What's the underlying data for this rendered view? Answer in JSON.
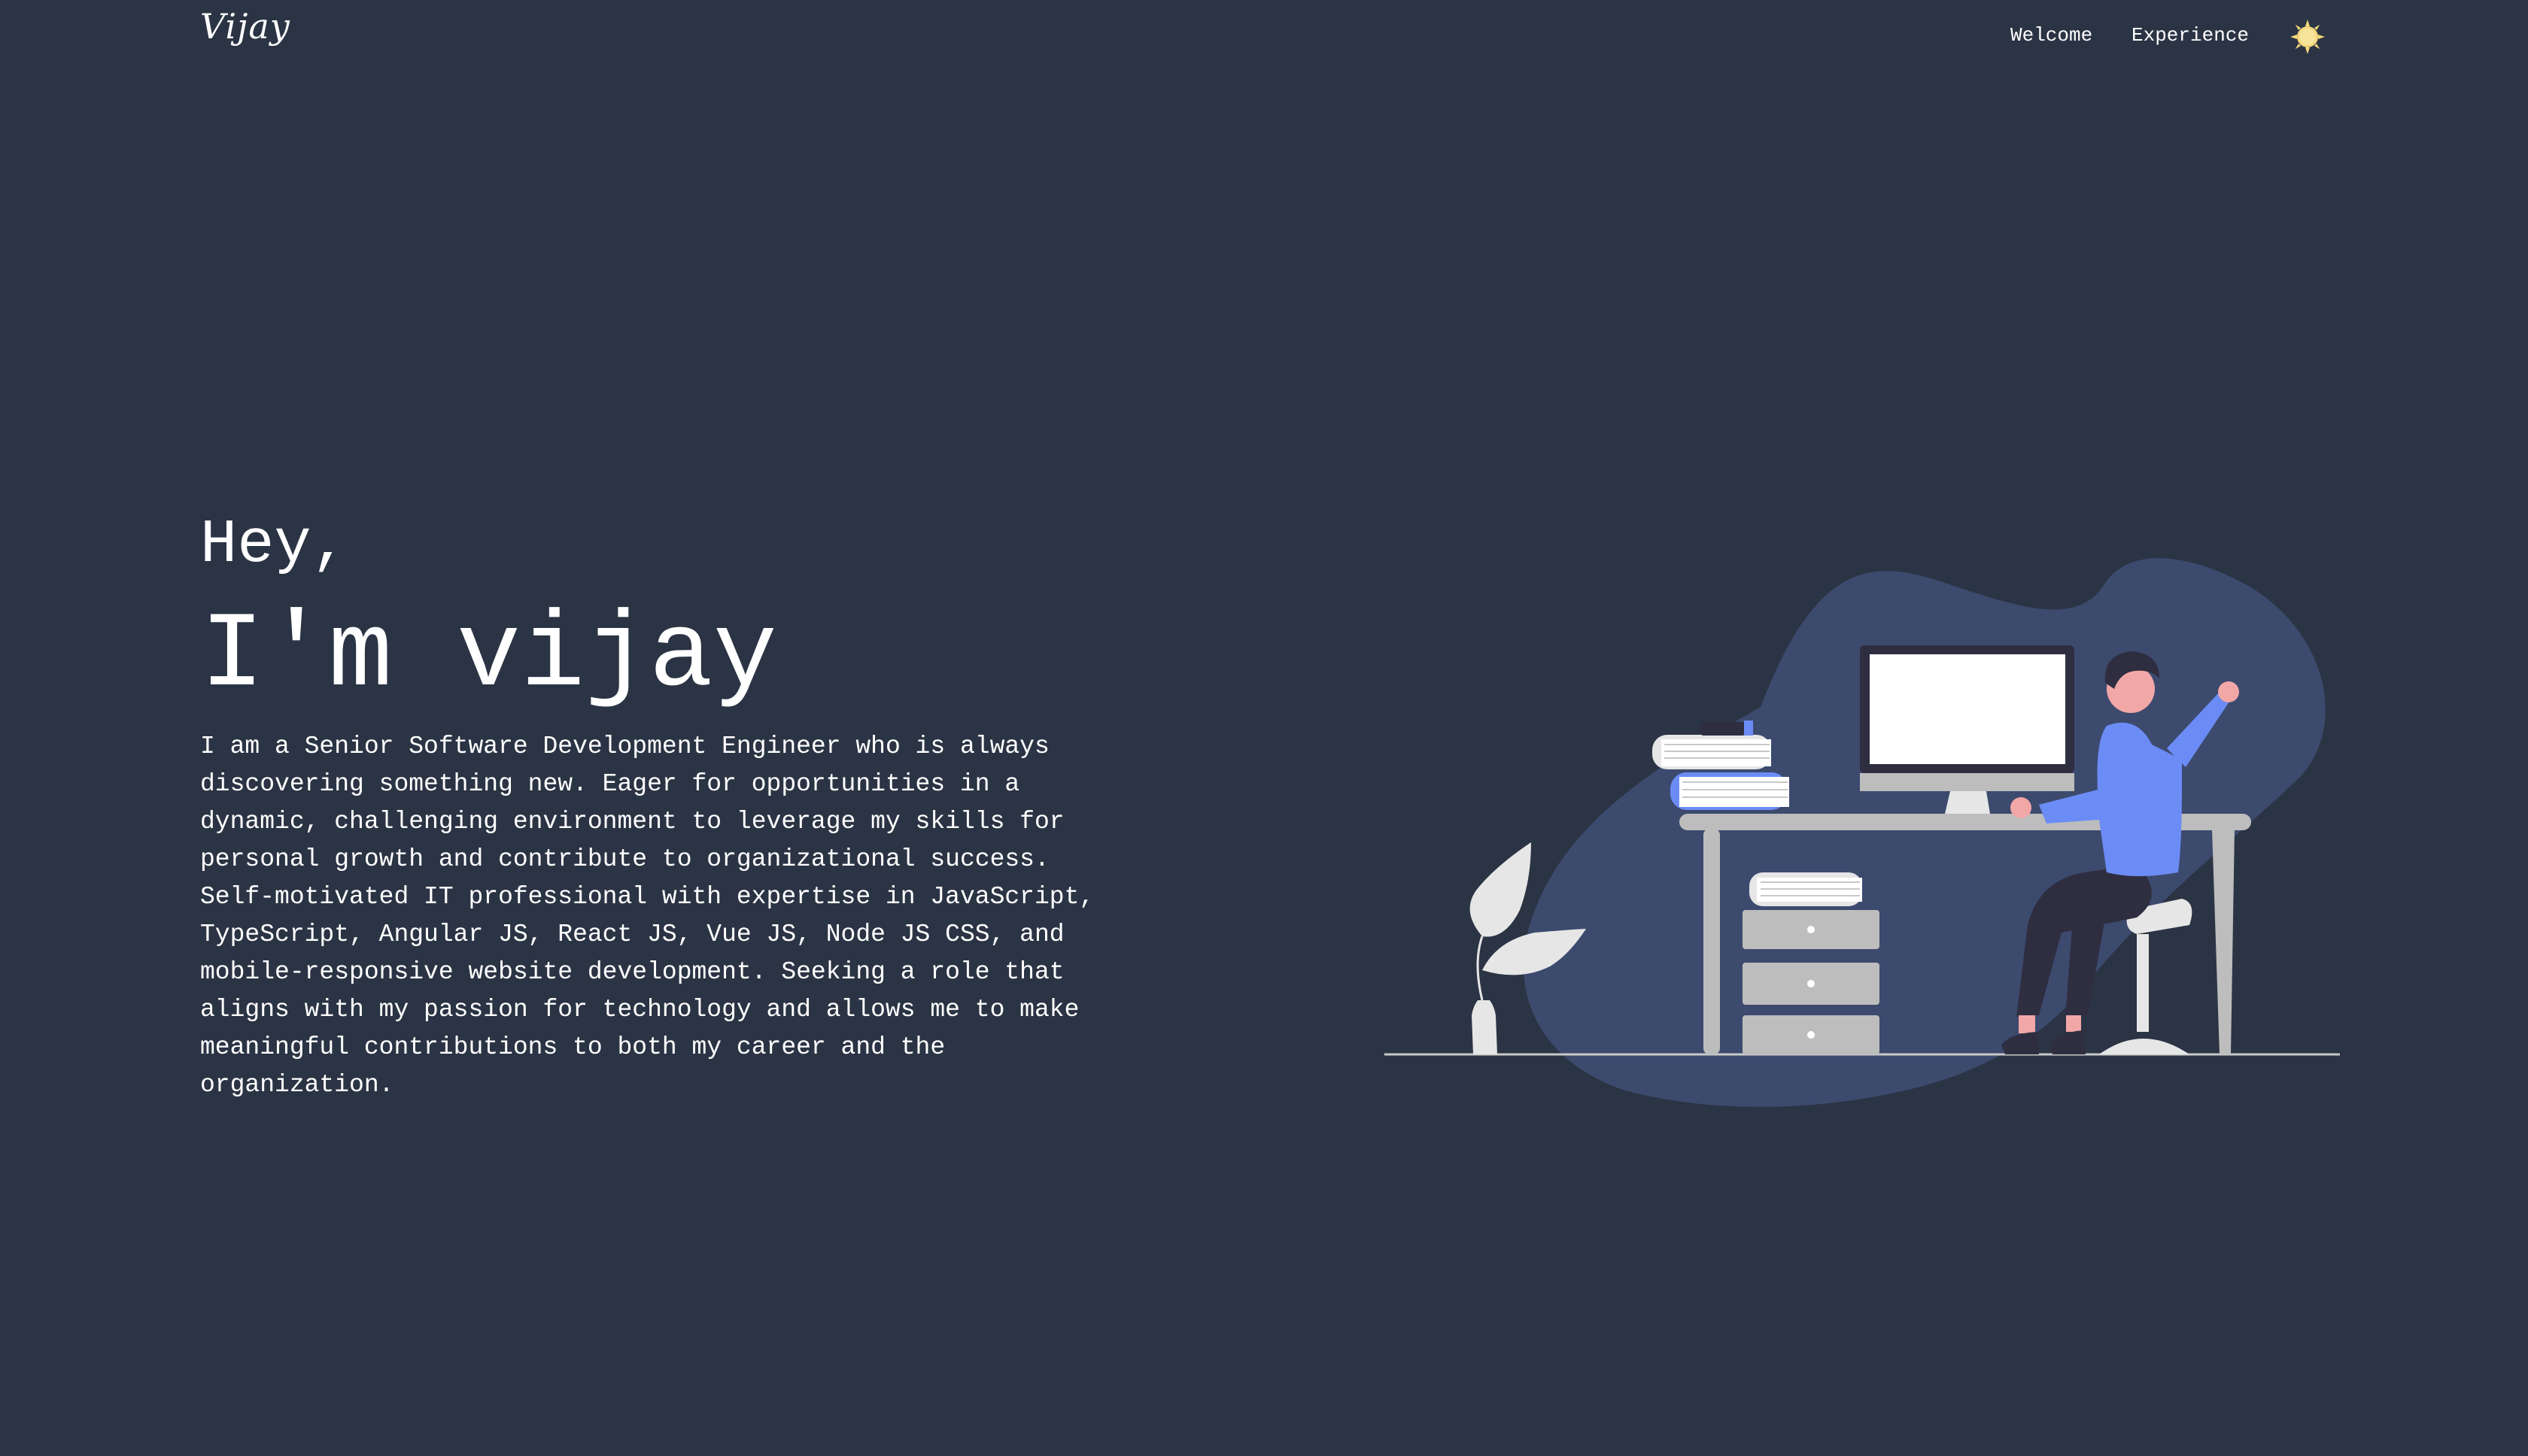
{
  "nav": {
    "logo": "Vijay",
    "links": [
      {
        "label": "Welcome"
      },
      {
        "label": "Experience"
      }
    ],
    "theme_toggle_icon": "sun-icon"
  },
  "hero": {
    "greeting": "Hey,",
    "name": "I'm vijay",
    "bio": "I am a Senior Software Development Engineer who is always discovering something new. Eager for opportunities in a dynamic, challenging environment to leverage my skills for personal growth and contribute to organizational success. Self-motivated IT professional with expertise in JavaScript, TypeScript, Angular JS, React JS, Vue JS, Node JS CSS, and mobile-responsive website development. Seeking a role that aligns with my passion for technology and allows me to make meaningful contributions to both my career and the organization."
  },
  "illustration": {
    "icon": "developer-at-desk-illustration"
  },
  "colors": {
    "background": "#2b3444",
    "blob": "#3c4a6e",
    "accent": "#6c8cf5",
    "sun": "#f5d77a"
  }
}
